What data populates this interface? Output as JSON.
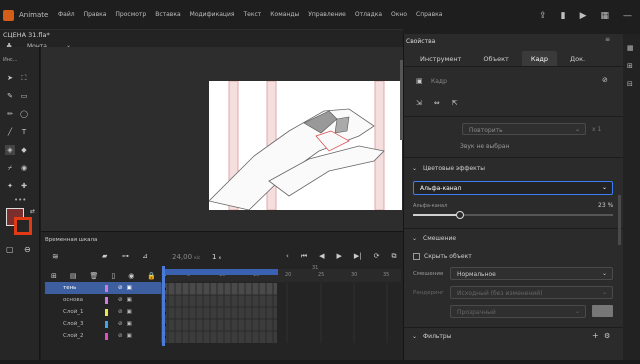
{
  "app": {
    "name": "Animate"
  },
  "menu": [
    "Файл",
    "Правка",
    "Просмотр",
    "Вставка",
    "Модификация",
    "Текст",
    "Команды",
    "Управление",
    "Отладка",
    "Окно",
    "Справка"
  ],
  "scene": {
    "name": "СЦЕНА 31.fla*",
    "mode": "Монта..."
  },
  "tools": {
    "header": "Инс..."
  },
  "timeline": {
    "title": "Временная шкала",
    "fps": "24,00",
    "fps_unit": "к/с",
    "frame": "1",
    "frame_unit": "к",
    "ruler": [
      "1",
      "5",
      "10",
      "15",
      "20",
      "25",
      "30",
      "35",
      "40"
    ],
    "marker": "31",
    "layers": [
      {
        "name": "тень",
        "color": "#d07be0",
        "selected": true
      },
      {
        "name": "основа",
        "color": "#d07be0"
      },
      {
        "name": "Слой_1",
        "color": "#e8e84a"
      },
      {
        "name": "Слой_3",
        "color": "#3fa6e8"
      },
      {
        "name": "Слой_2",
        "color": "#e050c0"
      }
    ]
  },
  "props": {
    "title": "Свойства",
    "tabs": [
      "Инструмент",
      "Объект",
      "Кадр",
      "Док."
    ],
    "active_tab": "Кадр",
    "frame_label": "Кадр",
    "repeat": "Повторить",
    "repeat_count": "x 1",
    "sound": "Звук не выбран",
    "color_effects": "Цветовые эффекты",
    "effect": "Альфа-канал",
    "alpha_label": "Альфа-канал",
    "alpha_value": "23",
    "alpha_unit": "%",
    "alpha_fraction": 0.23,
    "blending": "Смешение",
    "hide_object": "Скрыть объект",
    "blend_label": "Смешение",
    "blend_value": "Нормальное",
    "render_label": "Рендеринг",
    "render_value": "Исходный (без изменений)",
    "transparent": "Прозрачный",
    "filters": "Фильтры"
  },
  "colors": {
    "accent": "#3d7cf2",
    "stroke": "#7a2f2c",
    "fill": "#e33a16",
    "selected_layer": "#3d5fa0"
  }
}
